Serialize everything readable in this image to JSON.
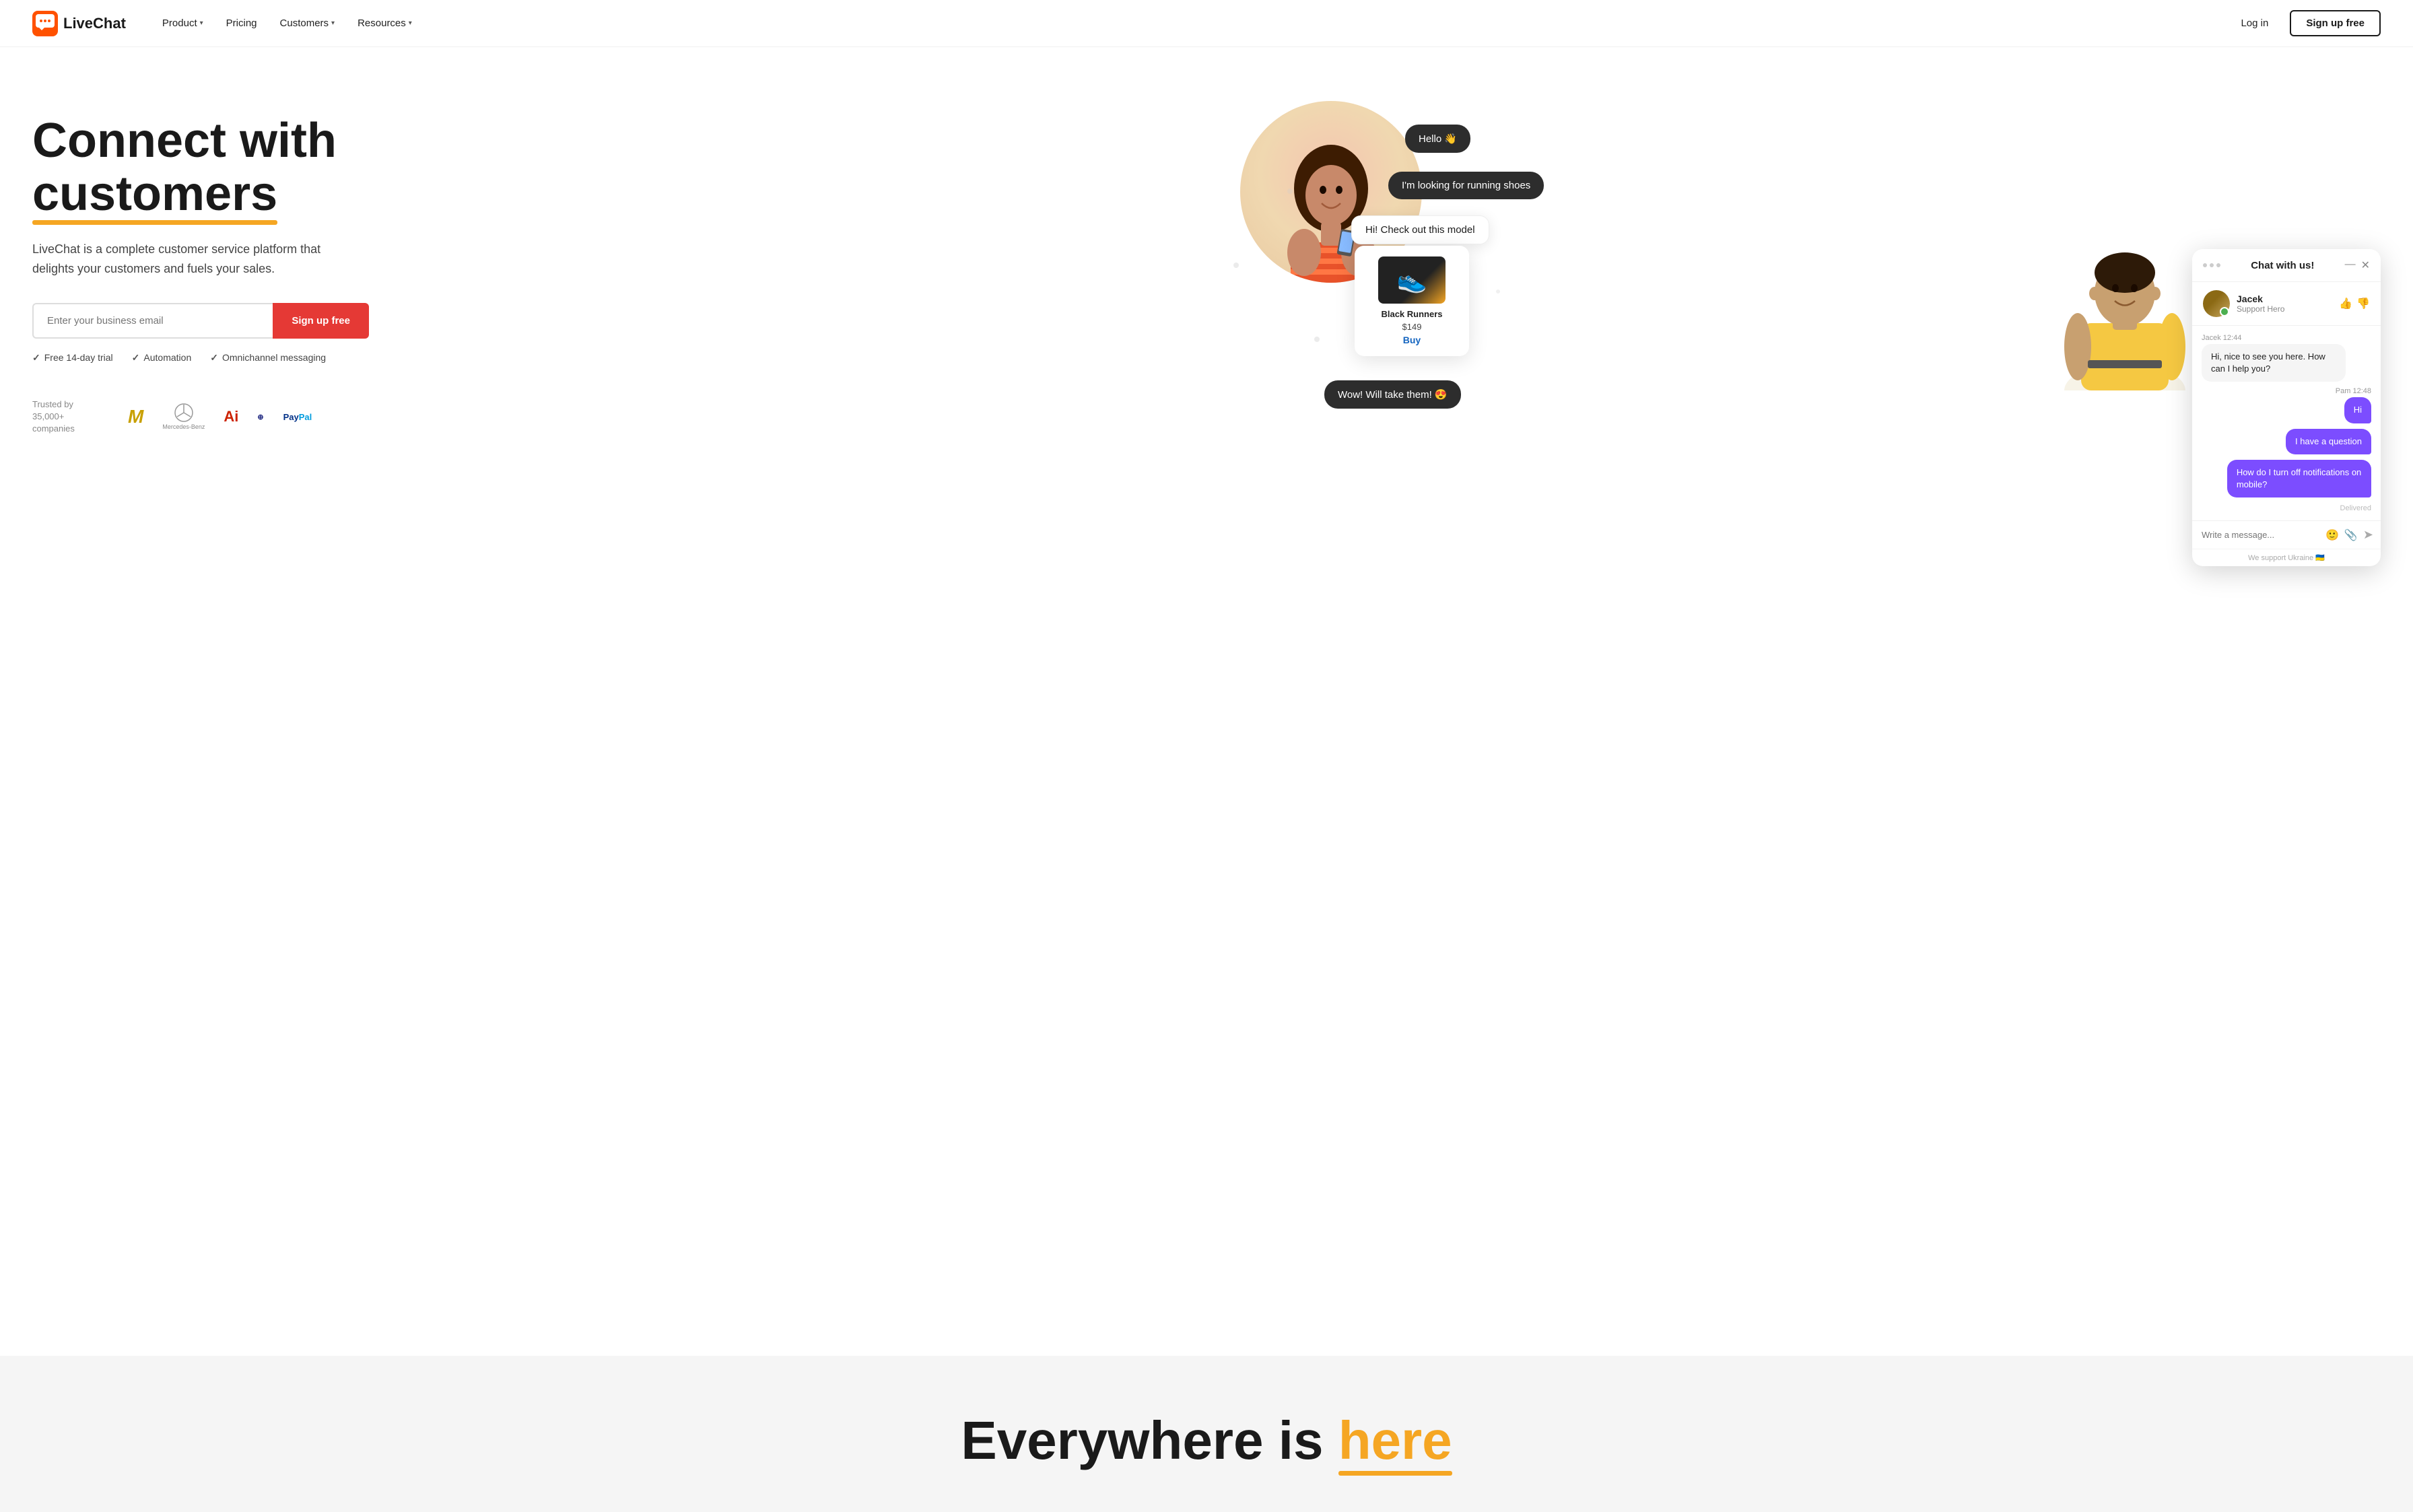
{
  "navbar": {
    "logo_text": "LiveChat",
    "nav_items": [
      {
        "label": "Product",
        "has_dropdown": true
      },
      {
        "label": "Pricing",
        "has_dropdown": false
      },
      {
        "label": "Customers",
        "has_dropdown": true
      },
      {
        "label": "Resources",
        "has_dropdown": true
      }
    ],
    "login_label": "Log in",
    "signup_label": "Sign up free"
  },
  "hero": {
    "headline_line1": "Connect with",
    "headline_line2": "customers",
    "description": "LiveChat is a complete customer service platform that delights your customers and fuels your sales.",
    "email_placeholder": "Enter your business email",
    "signup_button": "Sign up free",
    "features": [
      {
        "label": "Free 14-day trial"
      },
      {
        "label": "Automation"
      },
      {
        "label": "Omnichannel messaging"
      }
    ],
    "trusted_text": "Trusted by 35,000+ companies"
  },
  "chat_demo": {
    "bubble_hello": "Hello 👋",
    "bubble_shoes": "I'm looking for running shoes",
    "bubble_check": "Hi! Check out this model",
    "product_name": "Black Runners",
    "product_price": "$149",
    "buy_label": "Buy",
    "bubble_wow": "Wow! Will take them! 😍"
  },
  "chat_widget": {
    "title": "Chat with us!",
    "agent_name": "Jacek",
    "agent_role": "Support Hero",
    "msg_jacek_time": "Jacek 12:44",
    "msg_jacek_text": "Hi, nice to see you here. How can I help you?",
    "msg_pam_time": "Pam 12:48",
    "msg_hi": "Hi",
    "msg_question": "I have a question",
    "msg_long": "How do I turn off notifications on mobile?",
    "msg_delivered": "Delivered",
    "input_placeholder": "Write a message...",
    "footer_text": "We support Ukraine 🇺🇦"
  },
  "bottom": {
    "text_everywhere": "Everywhere is ",
    "text_here": "here"
  }
}
